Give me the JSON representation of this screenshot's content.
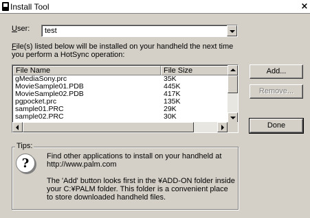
{
  "window": {
    "title": "Install Tool",
    "close": "×"
  },
  "user": {
    "label_u": "U",
    "label_rest": "ser:",
    "value": "test"
  },
  "description": {
    "prefix_u": "F",
    "text": "ile(s) listed below will be installed on your handheld the next time you perform a HotSync operation:"
  },
  "list": {
    "columns": [
      "File Name",
      "File Size"
    ],
    "rows": [
      {
        "name": "gMediaSony.prc",
        "size": "35K"
      },
      {
        "name": "MovieSample01.PDB",
        "size": "445K"
      },
      {
        "name": "MovieSample02.PDB",
        "size": "417K"
      },
      {
        "name": "pgpocket.prc",
        "size": "135K"
      },
      {
        "name": "sample01.PRC",
        "size": "29K"
      },
      {
        "name": "sample02.PRC",
        "size": "30K"
      }
    ]
  },
  "buttons": {
    "add": "Add...",
    "remove": "Remove...",
    "done": "Done"
  },
  "tips": {
    "label": "Tips:",
    "para1": "Find other applications to install on your handheld at http://www.palm.com",
    "para2": "The 'Add' button looks first in the ¥ADD-ON folder inside your C:¥PALM folder. This folder is a convenient place to store downloaded handheld files."
  },
  "icons": {
    "app": "app-icon",
    "help": "question-icon",
    "combo_arrow": "chevron-down-icon",
    "scroll_up": "arrow-up-icon",
    "scroll_down": "arrow-down-icon",
    "scroll_left": "arrow-left-icon",
    "scroll_right": "arrow-right-icon"
  },
  "colors": {
    "dialog": "#d4d0c8",
    "field": "#ffffff",
    "disabled_text": "#808080"
  }
}
